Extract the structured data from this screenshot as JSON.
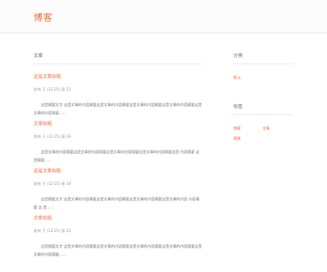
{
  "site": {
    "logo": "博客"
  },
  "main": {
    "section_title": "文章",
    "posts": [
      {
        "title": "这是文章标题",
        "meta": "发布 于 (12-25) 阅 22",
        "excerpt": "这是摘要文字 这是文章的内容摘要这是文章的内容摘要这是文章的内容摘要这是文章的内容摘要这是文章的内容摘要......"
      },
      {
        "title": "文章标题",
        "meta": "发布 于 (12-25) 阅 19",
        "excerpt": "这是文章的内容摘要这是文章的内容摘要这是文章的内容摘要这是文章的内容摘要这是 内容摘要 这是摘要......"
      },
      {
        "title": "这是文章标题",
        "meta": "发布 于 (12-25) 阅 18",
        "excerpt": "这是摘要文字 这是文章的内容摘要这是文章的内容摘要这是文章的内容摘要这是文章的内容 内容摘要 这 是......"
      },
      {
        "title": "文章标题",
        "meta": "发布 于 (12-25) 阅 25",
        "excerpt": "这是摘要文字 这是文章的内容摘要这是文章的内容摘要这是文章的内容摘要这是文章的内容摘要这是文章的内容摘要......"
      }
    ]
  },
  "sidebar": {
    "block1": {
      "title": "分类",
      "links": [
        "默认"
      ]
    },
    "block2": {
      "title": "标签",
      "links": [
        "博客",
        "文章",
        "随笔"
      ]
    }
  }
}
